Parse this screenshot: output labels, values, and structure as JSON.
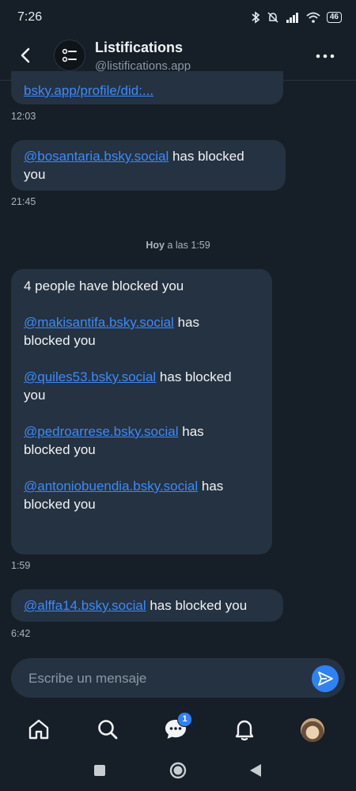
{
  "status": {
    "time": "7:26",
    "battery": "46"
  },
  "header": {
    "title": "Listifications",
    "handle": "@listifications.app"
  },
  "messages": [
    {
      "link": "bsky.app/profile/did:...",
      "time": "12:03"
    },
    {
      "link": "@bosantaria.bsky.social",
      "text": " has blocked",
      "text2": "you",
      "time": "21:45"
    }
  ],
  "date_separator": {
    "day": "Hoy",
    "rest": " a las 1:59"
  },
  "big_message": {
    "intro": "4 people have blocked you",
    "entries": [
      {
        "link": "@makisantifa.bsky.social",
        "after": " has",
        "line2": "blocked you"
      },
      {
        "link": "@quiles53.bsky.social",
        "after": " has blocked",
        "line2": "you"
      },
      {
        "link": "@pedroarrese.bsky.social",
        "after": " has",
        "line2": "blocked you"
      },
      {
        "link": "@antoniobuendia.bsky.social",
        "after": " has",
        "line2": "blocked you"
      }
    ],
    "time": "1:59"
  },
  "last_message": {
    "link": "@alffa14.bsky.social",
    "text": " has blocked you",
    "time": "6:42"
  },
  "composer": {
    "placeholder": "Escribe un mensaje"
  },
  "nav": {
    "messages_badge": "1"
  },
  "colors": {
    "background": "#161e27",
    "bubble": "#253241",
    "link": "#3a8bfd",
    "accent": "#2e82f7"
  }
}
